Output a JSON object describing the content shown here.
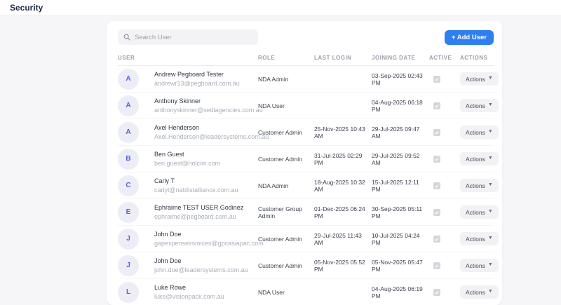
{
  "page": {
    "title": "Security"
  },
  "toolbar": {
    "search_placeholder": "Search User",
    "search_value": "",
    "add_user_label": "+ Add User"
  },
  "colors": {
    "accent_blue": "#2f7ff0",
    "avatar_bg": "#ededf6",
    "avatar_text": "#5a5fd8",
    "page_bg": "#f6f6f8"
  },
  "icons": {
    "search": "search-icon",
    "chevron_down": "chevron-down-icon"
  },
  "table": {
    "columns": [
      {
        "key": "user",
        "label": "USER"
      },
      {
        "key": "role",
        "label": "ROLE"
      },
      {
        "key": "last",
        "label": "LAST LOGIN"
      },
      {
        "key": "join",
        "label": "JOINING DATE"
      },
      {
        "key": "active",
        "label": "ACTIVE"
      },
      {
        "key": "actions",
        "label": "ACTIONS"
      }
    ],
    "actions_label": "Actions",
    "rows": [
      {
        "initial": "A",
        "name": "Andrew Pegboard Tester",
        "email": "andrewr13@pegboard.com.au",
        "role": "NDA Admin",
        "last_login": "",
        "joining_date": "03-Sep-2025 02:43 PM",
        "active": true
      },
      {
        "initial": "A",
        "name": "Anthony Skinner",
        "email": "anthonyskinner@sedlagencies.com.au",
        "role": "NDA User",
        "last_login": "",
        "joining_date": "04-Aug-2025 06:18 PM",
        "active": true
      },
      {
        "initial": "A",
        "name": "Axel Henderson",
        "email": "Axel.Henderson@leadersystems.com.au",
        "role": "Customer Admin",
        "last_login": "25-Nov-2025 10:43 AM",
        "joining_date": "29-Jul-2025 09:47 AM",
        "active": true
      },
      {
        "initial": "B",
        "name": "Ben Guest",
        "email": "ben.guest@holcim.com",
        "role": "Customer Admin",
        "last_login": "31-Jul-2025 02:29 PM",
        "joining_date": "29-Jul-2025 09:52 AM",
        "active": true
      },
      {
        "initial": "C",
        "name": "Carly T",
        "email": "carlyt@natdistalliance.com.au",
        "role": "NDA Admin",
        "last_login": "18-Aug-2025 10:32 AM",
        "joining_date": "15-Jul-2025 12:11 PM",
        "active": true
      },
      {
        "initial": "E",
        "name": "Ephraime TEST USER Godinez",
        "email": "ephraime@pegboard.com.au",
        "role": "Customer Group Admin",
        "last_login": "01-Dec-2025 06:24 PM",
        "joining_date": "30-Sep-2025 05:11 PM",
        "active": true
      },
      {
        "initial": "J",
        "name": "John Doe",
        "email": "gapexpenseinvoices@gpcasiapac.com",
        "role": "Customer Admin",
        "last_login": "29-Jul-2025 11:43 AM",
        "joining_date": "10-Jul-2025 04:24 PM",
        "active": true
      },
      {
        "initial": "J",
        "name": "John Doe",
        "email": "john.doe@leadersystems.com.au",
        "role": "Customer Admin",
        "last_login": "05-Nov-2025 05:52 PM",
        "joining_date": "05-Nov-2025 05:47 PM",
        "active": true
      },
      {
        "initial": "L",
        "name": "Luke Rowe",
        "email": "luke@visionpack.com.au",
        "role": "NDA User",
        "last_login": "",
        "joining_date": "04-Aug-2025 06:19 PM",
        "active": true
      }
    ]
  }
}
